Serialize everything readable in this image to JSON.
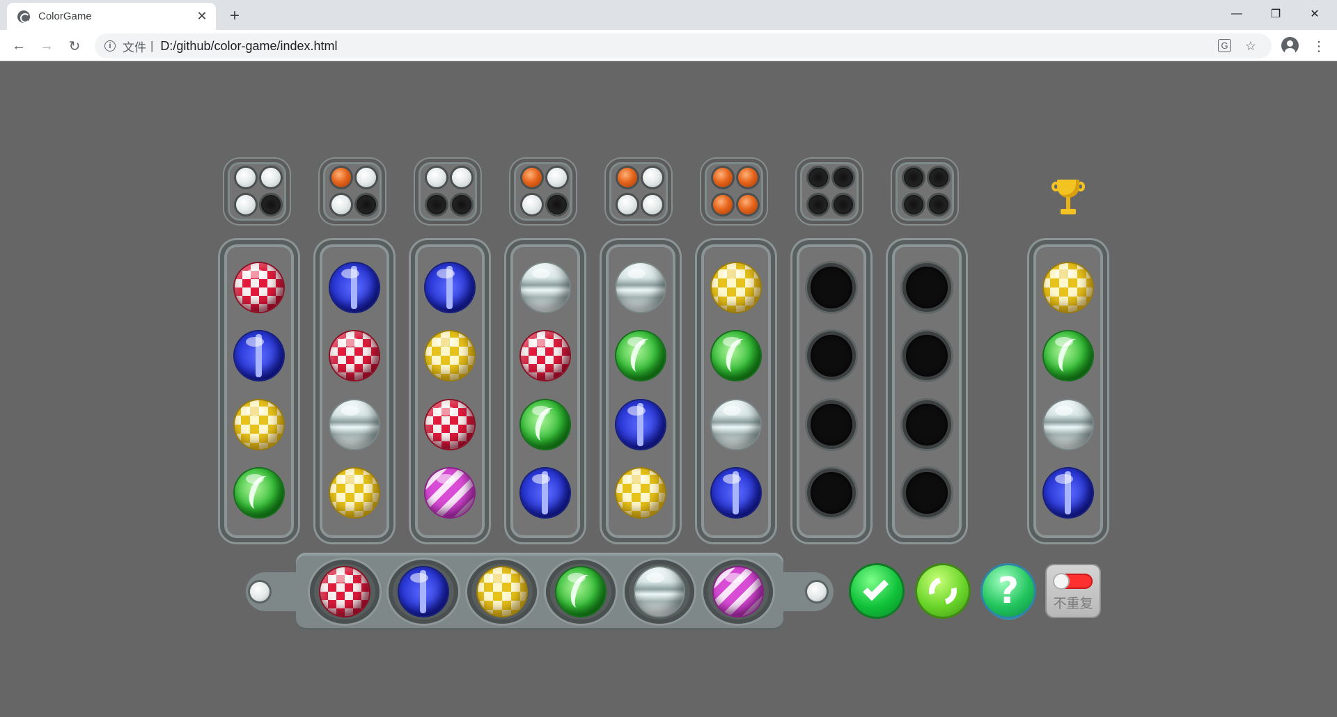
{
  "browser": {
    "tab_title": "ColorGame",
    "tab_close": "✕",
    "new_tab": "+",
    "minimize": "—",
    "restore": "❐",
    "close": "✕",
    "back": "←",
    "forward": "→",
    "reload": "↻",
    "scheme_label": "文件",
    "separator": "|",
    "url": "D:/github/color-game/index.html",
    "bookmark": "☆",
    "translate": "G",
    "menu": "⋮"
  },
  "game": {
    "hints": [
      [
        "white",
        "white",
        "white",
        "empty"
      ],
      [
        "red",
        "white",
        "white",
        "empty"
      ],
      [
        "white",
        "white",
        "empty",
        "empty"
      ],
      [
        "red",
        "white",
        "white",
        "empty"
      ],
      [
        "red",
        "white",
        "white",
        "white"
      ],
      [
        "red",
        "red",
        "red",
        "red"
      ],
      [
        "empty",
        "empty",
        "empty",
        "empty"
      ],
      [
        "empty",
        "empty",
        "empty",
        "empty"
      ]
    ],
    "guesses": [
      [
        "red",
        "blue",
        "yellow",
        "green"
      ],
      [
        "blue",
        "red",
        "white",
        "yellow"
      ],
      [
        "blue",
        "yellow",
        "red",
        "purple"
      ],
      [
        "white",
        "red",
        "green",
        "blue"
      ],
      [
        "white",
        "green",
        "blue",
        "yellow"
      ],
      [
        "yellow",
        "green",
        "white",
        "blue"
      ],
      [
        "empty",
        "empty",
        "empty",
        "empty"
      ],
      [
        "empty",
        "empty",
        "empty",
        "empty"
      ]
    ],
    "answer": [
      "yellow",
      "green",
      "white",
      "blue"
    ],
    "palette": [
      "red",
      "blue",
      "yellow",
      "green",
      "white",
      "purple"
    ],
    "no_repeat_label": "不重复",
    "no_repeat_enabled": true,
    "icons": {
      "trophy": "trophy-icon",
      "check": "check-icon",
      "restart": "restart-icon",
      "help": "help-icon",
      "help_glyph": "?"
    }
  }
}
